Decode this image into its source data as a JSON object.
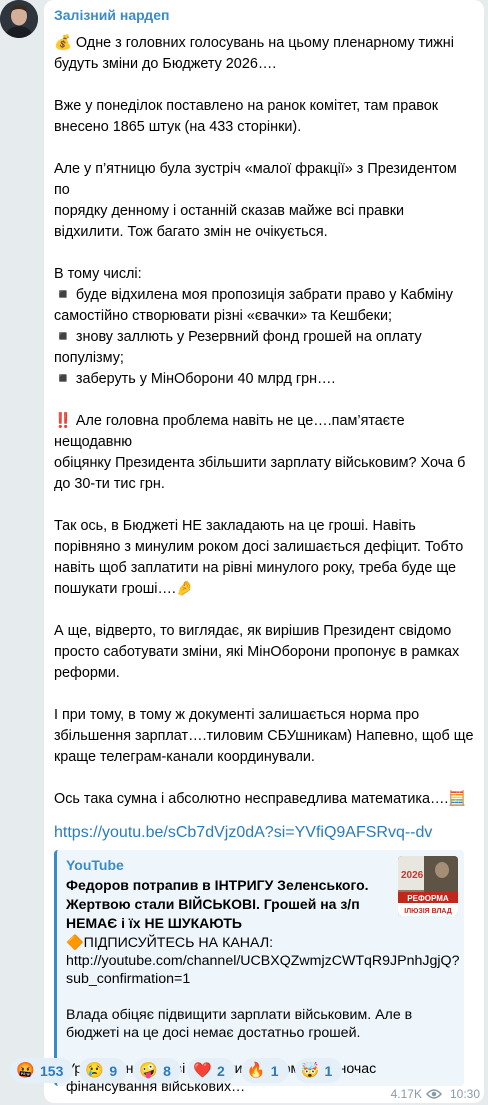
{
  "channel": {
    "name": "Залізний нардеп"
  },
  "message": {
    "paragraphs": [
      [
        "💰 Одне з головних голосувань на цьому пленарному тижні",
        "будуть зміни до Бюджету 2026…."
      ],
      [
        "Вже у понеділок поставлено на ранок комітет, там правок",
        "внесено 1865 штук (на 433 сторінки)."
      ],
      [
        "Але у п’ятницю була зустріч «малої фракції» з Президентом по",
        "порядку денному і останній сказав майже всі правки",
        "відхилити. Тож багато змін не очікується."
      ],
      [
        "В тому числі:",
        "◾️ буде відхилена моя пропозиція забрати право у Кабміну",
        "самостійно створювати різні «євачки» та Кешбеки;",
        "◾️ знову заллють у Резервний фонд грошей на оплату",
        "популізму;",
        "◾️ заберуть у МінОборони 40 млрд грн…."
      ],
      [
        "‼️ Але головна проблема навіть не це….пам’ятаєте нещодавню",
        "обіцянку Президента збільшити зарплату військовим? Хоча б",
        "до 30-ти тис грн."
      ],
      [
        "Так ось, в Бюджеті НЕ закладають на це гроші. Навіть",
        "порівняно з минулим роком досі залишається дефіцит. Тобто",
        "навіть щоб заплатити на рівні минулого року, треба буде ще",
        "пошукати гроші….🤌"
      ],
      [
        "А ще, відверто, то виглядає, як вирішив Президент свідомо",
        "просто саботувати зміни, які МінОборони пропонує в рамках",
        "реформи."
      ],
      [
        "І при тому, в тому ж документі залишається норма про",
        "збільшення зарплат….тиловим СБУшникам) Напевно, щоб ще",
        "краще телеграм-канали координували."
      ],
      [
        "Ось така сумна і абсолютно несправедлива математика….🧮"
      ]
    ],
    "link": "https://youtu.be/sCb7dVjz0dA?si=YVfiQ9AFSRvq--dv"
  },
  "preview": {
    "site": "YouTube",
    "title": "Федоров потрапив в ІНТРИГУ Зеленського. Жертвою стали ВІЙСЬКОВІ. Грошей на з/п НЕМАЄ і їх НЕ ШУКАЮТЬ",
    "desc_lines": [
      "🔶ПІДПИСУЙТЕСЬ НА КАНАЛ:",
      "http://youtube.com/channel/UCBXQZwmjzCWTqR9JPnhJgjQ?",
      "sub_confirmation=1",
      "",
      "Влада обіцяє підвищити зарплати військовим. Але в",
      "бюджеті на це досі немає достатньо грошей.",
      "",
      "Уряд анонсує нові виплати для армії, водночас",
      "фінансування військових…"
    ],
    "thumb_text": {
      "year": "2026",
      "line1": "РЕФОРМА",
      "line2": "ІЛЮЗІЯ ВЛАД"
    }
  },
  "reactions": [
    {
      "icon": "angry-face-icon",
      "emoji": "🤬",
      "count": "153"
    },
    {
      "icon": "crying-face-icon",
      "emoji": "😢",
      "count": "9"
    },
    {
      "icon": "zany-face-icon",
      "emoji": "🤪",
      "count": "8"
    },
    {
      "icon": "heart-icon",
      "emoji": "❤️",
      "count": "2"
    },
    {
      "icon": "fire-icon",
      "emoji": "🔥",
      "count": "1"
    },
    {
      "icon": "exploding-head-icon",
      "emoji": "🤯",
      "count": "1"
    }
  ],
  "meta": {
    "views": "4.17K",
    "time": "10:30"
  },
  "colors": {
    "accent": "#3a8bc9",
    "link": "#2a7bbf",
    "background": "#e6ebee"
  }
}
